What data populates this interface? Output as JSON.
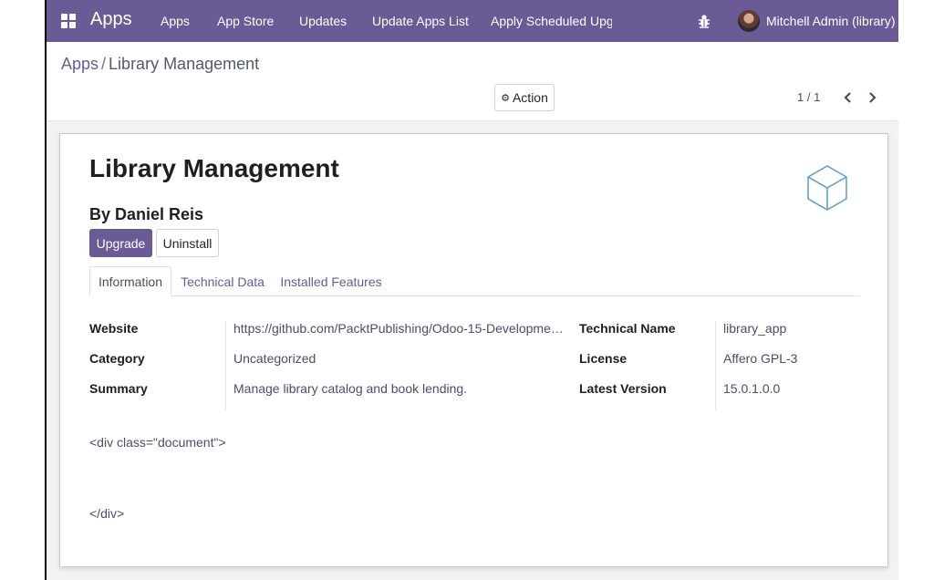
{
  "navbar": {
    "brand": "Apps",
    "menu": [
      "Apps",
      "App Store",
      "Updates",
      "Update Apps List",
      "Apply Scheduled Upgrades"
    ],
    "user": "Mitchell Admin (library)",
    "icons": {
      "grid": "apps-grid-icon",
      "debug": "bug-icon",
      "avatar": "user-avatar"
    }
  },
  "breadcrumb": {
    "parent": "Apps",
    "separator": "/",
    "current": "Library Management"
  },
  "control_panel": {
    "action_label": "Action",
    "pager": "1 / 1"
  },
  "module": {
    "title": "Library Management",
    "author": "By Daniel Reis",
    "upgrade_label": "Upgrade",
    "uninstall_label": "Uninstall"
  },
  "tabs": [
    "Information",
    "Technical Data",
    "Installed Features"
  ],
  "info_left": [
    {
      "label": "Website",
      "value": "https://github.com/PacktPublishing/Odoo-15-Developme…"
    },
    {
      "label": "Category",
      "value": "Uncategorized"
    },
    {
      "label": "Summary",
      "value": "Manage library catalog and book lending."
    }
  ],
  "info_right": [
    {
      "label": "Technical Name",
      "value": "library_app"
    },
    {
      "label": "License",
      "value": "Affero GPL-3"
    },
    {
      "label": "Latest Version",
      "value": "15.0.1.0.0"
    }
  ],
  "description": {
    "open": "<div class=\"document\">",
    "close": "</div>"
  },
  "colors": {
    "brand": "#6a5a96",
    "link": "#6a5a96",
    "background": "#f2f2f4"
  }
}
